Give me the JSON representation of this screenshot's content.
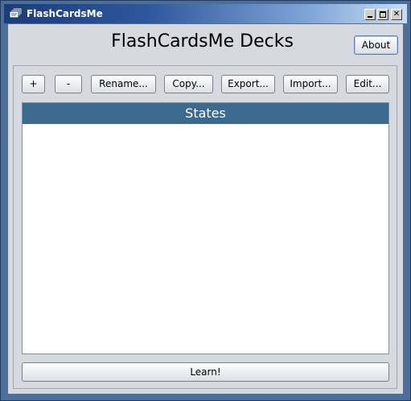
{
  "window": {
    "title": "FlashCardsMe",
    "controls": {
      "minimize_icon": "minimize-icon",
      "maximize_icon": "maximize-icon",
      "close_label": "✕"
    }
  },
  "header": {
    "title": "FlashCardsMe Decks",
    "about_label": "About"
  },
  "toolbar": {
    "add_label": "+",
    "remove_label": "-",
    "rename_label": "Rename...",
    "copy_label": "Copy...",
    "export_label": "Export...",
    "import_label": "Import...",
    "edit_label": "Edit..."
  },
  "decks": {
    "items": [
      {
        "label": "States",
        "selected": true
      }
    ]
  },
  "footer": {
    "learn_label": "Learn!"
  },
  "colors": {
    "selection": "#3b6a8e",
    "titlebar_dark": "#1a3c7a",
    "titlebar_light": "#c8dcf3",
    "client_bg": "#d6d9df",
    "frame": "#4b6f9c"
  }
}
